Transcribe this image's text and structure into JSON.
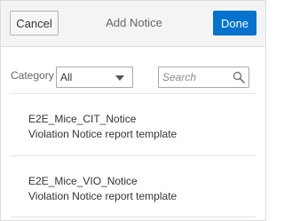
{
  "header": {
    "cancel_label": "Cancel",
    "title": "Add Notice",
    "done_label": "Done"
  },
  "filter": {
    "category_label": "Category",
    "category_value": "All",
    "search_placeholder": "Search"
  },
  "notices": [
    {
      "name": "E2E_Mice_CIT_Notice",
      "description": "Violation Notice report template"
    },
    {
      "name": "E2E_Mice_VIO_Notice",
      "description": "Violation Notice report template"
    }
  ],
  "colors": {
    "primary": "#0572ce",
    "header_bg": "#f4f4f4"
  },
  "icons": {
    "search": "search-icon",
    "dropdown": "chevron-down-icon"
  }
}
